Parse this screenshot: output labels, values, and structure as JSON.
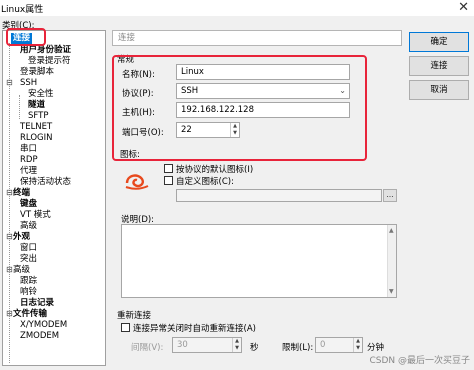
{
  "window": {
    "title": "Linux属性",
    "close_glyph": "✕"
  },
  "category_label": "类别(C):",
  "tree": {
    "items": [
      {
        "label": "连接",
        "selected": true
      },
      {
        "label": "用户身份验证"
      },
      {
        "label": "登录提示符"
      },
      {
        "label": "登录脚本"
      },
      {
        "label": "SSH"
      },
      {
        "label": "安全性"
      },
      {
        "label": "隧道"
      },
      {
        "label": "SFTP"
      },
      {
        "label": "TELNET"
      },
      {
        "label": "RLOGIN"
      },
      {
        "label": "串口"
      },
      {
        "label": "RDP"
      },
      {
        "label": "代理"
      },
      {
        "label": "保持活动状态"
      },
      {
        "label": "终端"
      },
      {
        "label": "键盘"
      },
      {
        "label": "VT 模式"
      },
      {
        "label": "高级"
      },
      {
        "label": "外观"
      },
      {
        "label": "窗口"
      },
      {
        "label": "突出"
      },
      {
        "label": "高级"
      },
      {
        "label": "跟踪"
      },
      {
        "label": "响铃"
      },
      {
        "label": "日志记录"
      },
      {
        "label": "文件传输"
      },
      {
        "label": "X/YMODEM"
      },
      {
        "label": "ZMODEM"
      }
    ]
  },
  "breadcrumb": "连接",
  "general": {
    "group_label": "常规",
    "name_label": "名称(N):",
    "name_value": "Linux",
    "protocol_label": "协议(P):",
    "protocol_value": "SSH",
    "host_label": "主机(H):",
    "host_value": "192.168.122.128",
    "port_label": "端口号(O):",
    "port_value": "22",
    "icon_label": "图标:",
    "icon_default_label": "按协议的默认图标(I)",
    "icon_custom_label": "自定义图标(C):",
    "desc_label": "说明(D):"
  },
  "reconnect": {
    "group_label": "重新连接",
    "auto_label": "连接异常关闭时自动重新连接(A)",
    "interval_label": "间隔(V):",
    "interval_value": "30",
    "interval_unit": "秒",
    "limit_label": "限制(L):",
    "limit_value": "0",
    "limit_unit": "分钟"
  },
  "buttons": {
    "ok": "确定",
    "connect": "连接",
    "cancel": "取消"
  },
  "watermark": "CSDN @最后一次买豆子",
  "colors": {
    "selection": "#0078d7",
    "highlight_box": "#e8243a",
    "icon_accent": "#e8491d"
  }
}
